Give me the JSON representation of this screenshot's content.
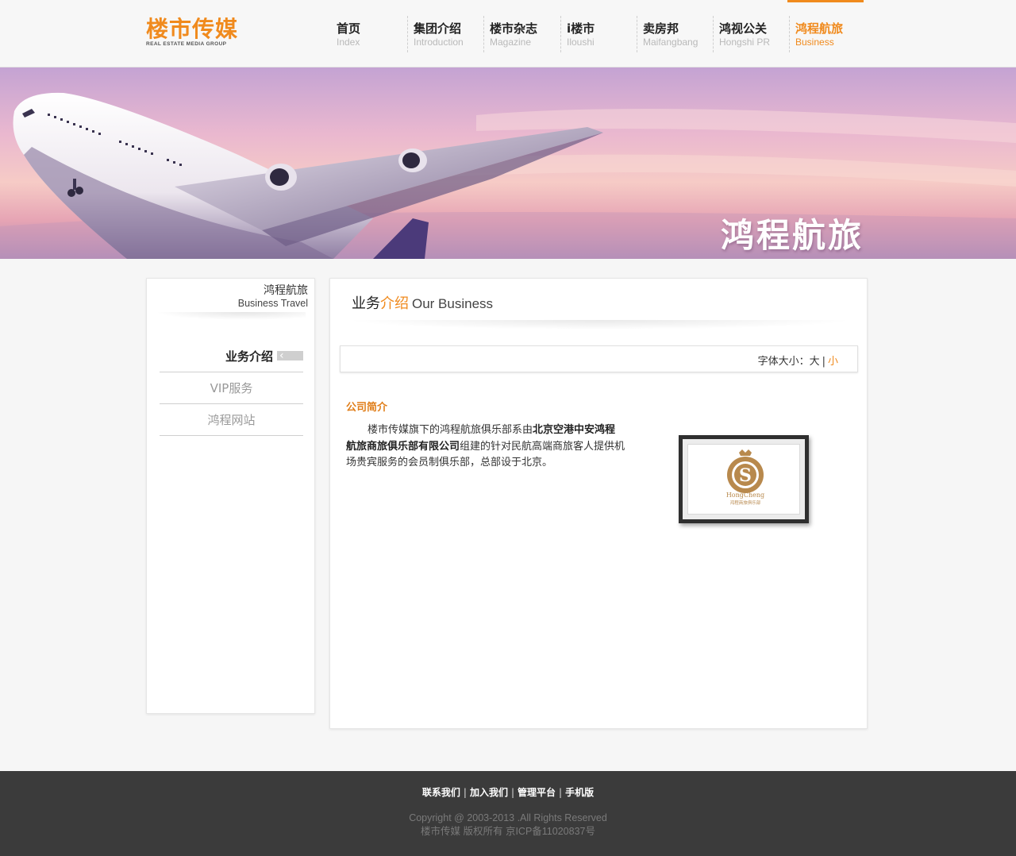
{
  "brand": {
    "logo_text": "楼市传媒",
    "logo_subtext": "REAL ESTATE MEDIA GROUP",
    "accent_color": "#f08a1d"
  },
  "nav": {
    "items": [
      {
        "cn": "首页",
        "en": "Index"
      },
      {
        "cn": "集团介绍",
        "en": "Introduction"
      },
      {
        "cn": "楼市杂志",
        "en": "Magazine"
      },
      {
        "cn": "i楼市",
        "en": "Iloushi"
      },
      {
        "cn": "卖房邦",
        "en": "Maifangbang"
      },
      {
        "cn": "鸿视公关",
        "en": "Hongshi PR"
      },
      {
        "cn": "鸿程航旅",
        "en": "Business",
        "active": true
      }
    ]
  },
  "banner": {
    "title": "鸿程航旅"
  },
  "sidebar": {
    "title_cn": "鸿程航旅",
    "title_en": "Business Travel",
    "items": [
      {
        "label": "业务介绍",
        "active": true
      },
      {
        "label": "VIP服务"
      },
      {
        "label": "鸿程网站"
      }
    ]
  },
  "main": {
    "title_part1": "业务",
    "title_part2": "介绍",
    "title_en": "Our Business",
    "font_size_label": "字体大小：",
    "font_big": "大",
    "font_sep": "|",
    "font_small": "小",
    "section_title": "公司简介",
    "para_part1": "楼市传媒旗下的鸿程航旅俱乐部系由",
    "para_bold": "北京空港中安鸿程航旅商旅俱乐部有限公司",
    "para_part2": "组建的针对民航高端商旅客人提供机场贵宾服务的会员制俱乐部，总部设于北京。",
    "logo_caption_en": "HongCheng",
    "logo_caption_cn": "鸿程商旅俱乐部"
  },
  "footer": {
    "links": [
      "联系我们",
      "加入我们",
      "管理平台",
      "手机版"
    ],
    "copyright": "Copyright @ 2003-2013 .All Rights Reserved",
    "icp": "楼市传媒 版权所有 京ICP备11020837号"
  }
}
